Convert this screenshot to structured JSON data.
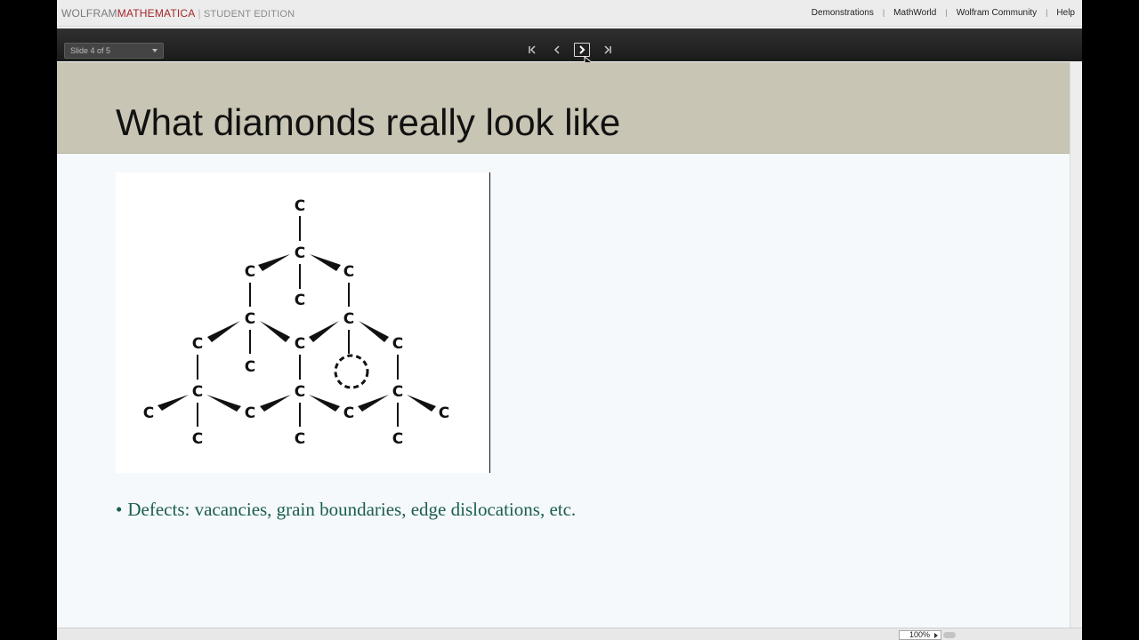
{
  "brand": {
    "wolfram": "WOLFRAM",
    "mathematica": "MATHEMATICA",
    "separator": "|",
    "edition": "STUDENT EDITION"
  },
  "toplinks": [
    "Demonstrations",
    "MathWorld",
    "Wolfram Community",
    "Help"
  ],
  "toolbar": {
    "slide_selector": "Slide 4 of 5"
  },
  "slide": {
    "title": "What diamonds really look like",
    "bullet": "Defects: vacancies, grain boundaries, edge dislocations, etc.",
    "bullet_marker": "•",
    "atom_label": "C"
  },
  "status": {
    "zoom": "100%"
  },
  "colors": {
    "title_band": "#c9c5b4",
    "slide_bg": "#f5f9fc",
    "bullet_text": "#1b5e4e",
    "brand_red": "#a3272a"
  }
}
